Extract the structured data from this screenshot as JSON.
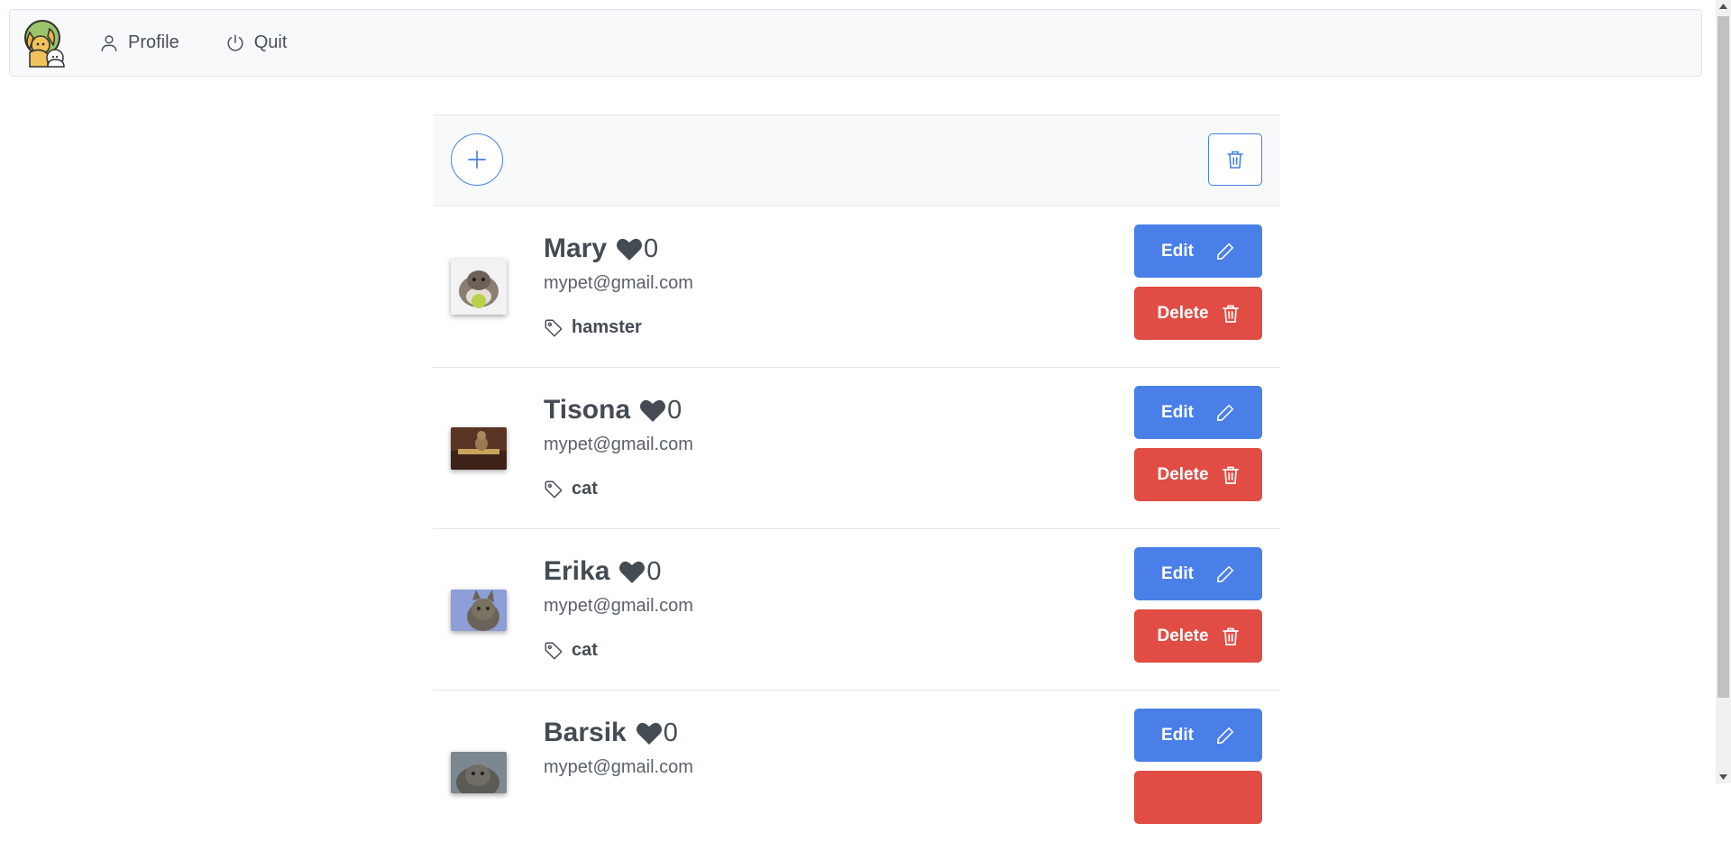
{
  "navbar": {
    "logo_icon": "pet-logo-icon",
    "links": [
      {
        "label": "Profile",
        "icon": "user-icon"
      },
      {
        "label": "Quit",
        "icon": "power-icon"
      }
    ]
  },
  "toolbar": {
    "add_icon": "plus-icon",
    "bulk_delete_icon": "trash-icon"
  },
  "pets": [
    {
      "name": "Mary",
      "likes": "0",
      "email": "mypet@gmail.com",
      "tag": "hamster",
      "photo": "hamster-photo"
    },
    {
      "name": "Tisona",
      "likes": "0",
      "email": "mypet@gmail.com",
      "tag": "cat",
      "photo": "cat-photo"
    },
    {
      "name": "Erika",
      "likes": "0",
      "email": "mypet@gmail.com",
      "tag": "cat",
      "photo": "cat-photo"
    },
    {
      "name": "Barsik",
      "likes": "0",
      "email": "mypet@gmail.com",
      "tag": "",
      "photo": "cat-photo"
    }
  ],
  "actions": {
    "edit_label": "Edit",
    "delete_label": "Delete"
  },
  "colors": {
    "primary": "#4a7fe8",
    "danger": "#e14d45",
    "navbar_bg": "#f8f9fa",
    "text": "#454b52"
  }
}
